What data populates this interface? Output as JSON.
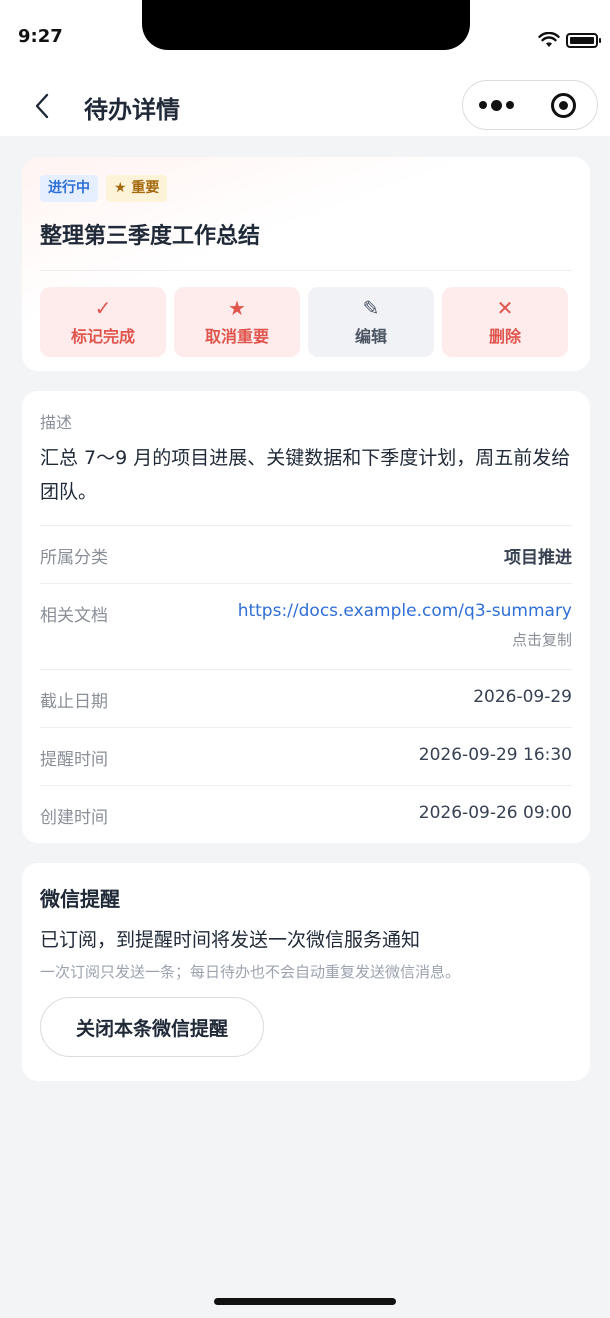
{
  "status_bar": {
    "time": "9:27"
  },
  "nav": {
    "title": "待办详情"
  },
  "task": {
    "status_tag": "进行中",
    "important_tag": "★ 重要",
    "title": "整理第三季度工作总结",
    "actions": [
      {
        "icon": "✓",
        "label": "标记完成"
      },
      {
        "icon": "★",
        "label": "取消重要"
      },
      {
        "icon": "✎",
        "label": "编辑"
      },
      {
        "icon": "✕",
        "label": "删除"
      }
    ]
  },
  "detail": {
    "description_label": "描述",
    "description": "汇总 7～9 月的项目进展、关键数据和下季度计划，周五前发给团队。",
    "category_label": "所属分类",
    "category": "项目推进",
    "doc_label": "相关文档",
    "doc_url": "https://docs.example.com/q3-summary",
    "copy_hint": "点击复制",
    "due_label": "截止日期",
    "due_date": "2026-09-29",
    "remind_label": "提醒时间",
    "remind_time": "2026-09-29 16:30",
    "created_label": "创建时间",
    "created_time": "2026-09-26 09:00"
  },
  "wechat": {
    "title": "微信提醒",
    "status": "已订阅，到提醒时间将发送一次微信服务通知",
    "note": "一次订阅只发送一条；每日待办也不会自动重复发送微信消息。",
    "button": "关闭本条微信提醒"
  },
  "colors": {
    "accent_red": "#e0554e",
    "link_blue": "#2f6fd6",
    "background": "#f3f4f6"
  }
}
